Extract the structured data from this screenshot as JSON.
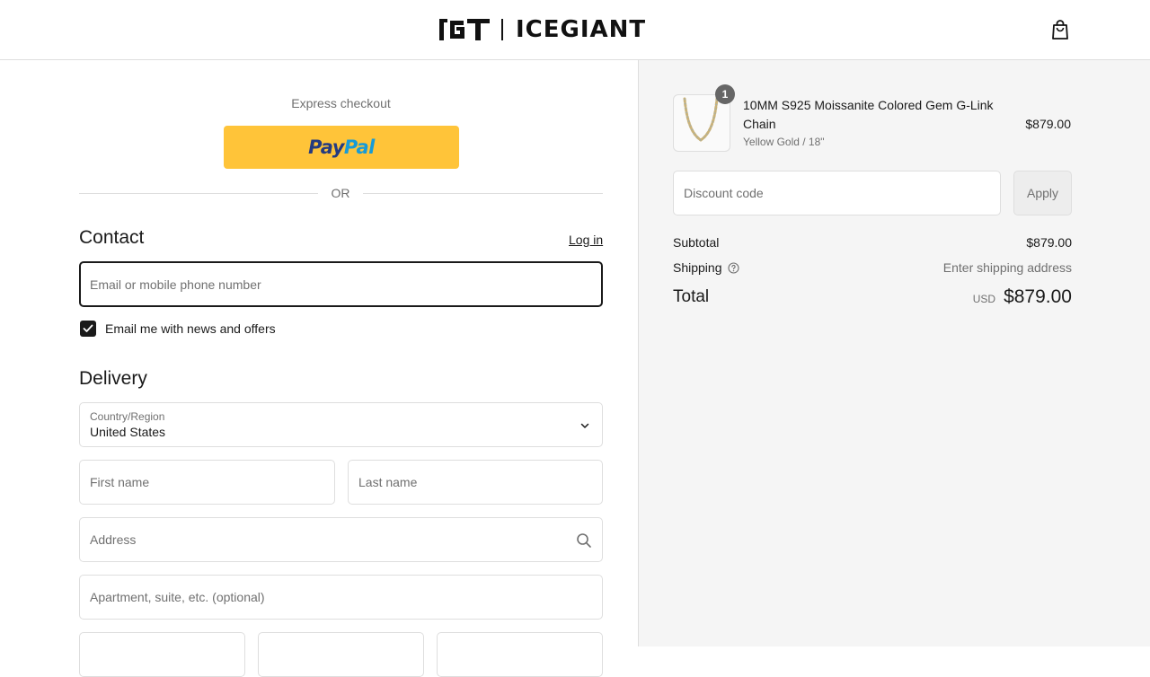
{
  "header": {
    "brand": "ICEGIANT",
    "logo_mark": "IGT"
  },
  "express": {
    "label": "Express checkout",
    "paypal_pay": "Pay",
    "paypal_pal": "Pal",
    "or_text": "OR"
  },
  "contact": {
    "title": "Contact",
    "login_label": "Log in",
    "email_placeholder": "Email or mobile phone number",
    "newsletter_label": "Email me with news and offers",
    "newsletter_checked": true
  },
  "delivery": {
    "title": "Delivery",
    "country_label": "Country/Region",
    "country_value": "United States",
    "first_name_placeholder": "First name",
    "last_name_placeholder": "Last name",
    "address_placeholder": "Address",
    "apartment_placeholder": "Apartment, suite, etc. (optional)"
  },
  "order": {
    "item": {
      "quantity": "1",
      "name": "10MM S925 Moissanite Colored Gem G-Link Chain",
      "variant": "Yellow Gold / 18\"",
      "price": "$879.00"
    },
    "discount_placeholder": "Discount code",
    "apply_label": "Apply",
    "subtotal_label": "Subtotal",
    "subtotal_value": "$879.00",
    "shipping_label": "Shipping",
    "shipping_value": "Enter shipping address",
    "total_label": "Total",
    "currency": "USD",
    "total_value": "$879.00"
  },
  "colors": {
    "paypal_yellow": "#ffc439",
    "paypal_dark_blue": "#253b80",
    "paypal_light_blue": "#179bd7",
    "text": "#1a1a1a",
    "muted": "#707070",
    "border": "#dedede",
    "sidebar_bg": "#f5f5f5"
  },
  "icons": {
    "cart": "shopping-bag-icon",
    "chevron": "chevron-down-icon",
    "search": "search-icon",
    "help": "question-circle-icon",
    "check": "check-icon"
  }
}
